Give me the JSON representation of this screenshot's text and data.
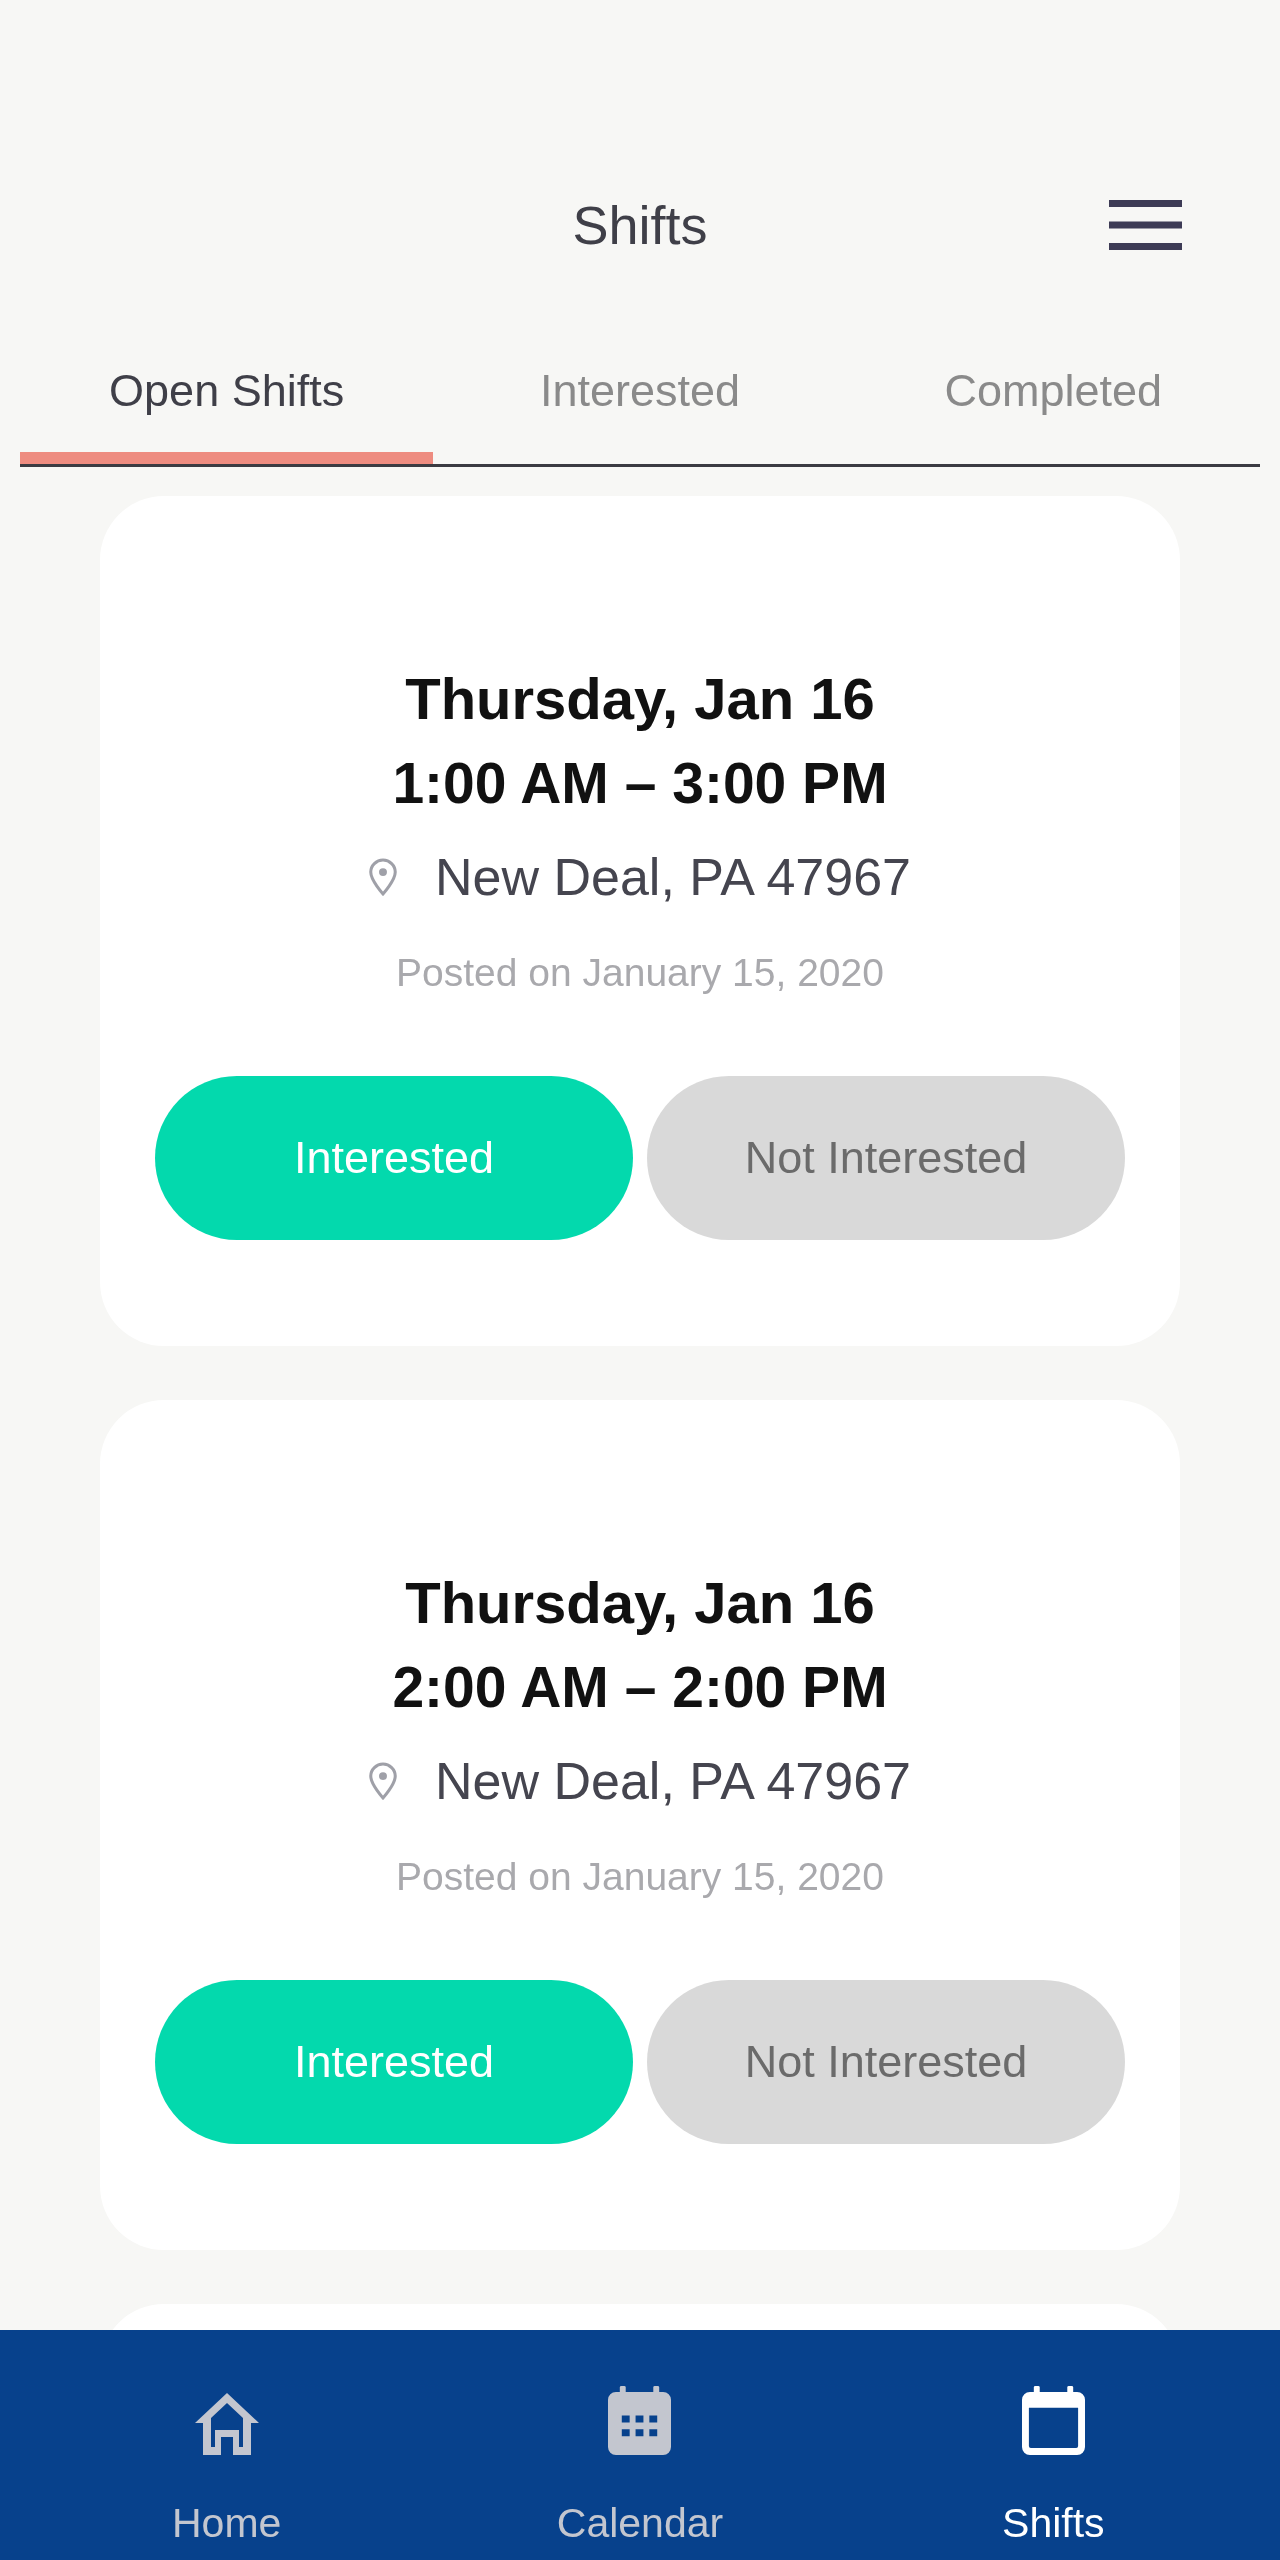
{
  "header": {
    "title": "Shifts"
  },
  "tabs": [
    {
      "label": "Open Shifts",
      "selected": true
    },
    {
      "label": "Interested",
      "selected": false
    },
    {
      "label": "Completed",
      "selected": false
    }
  ],
  "shifts": [
    {
      "date": "Thursday, Jan 16",
      "time": "1:00 AM – 3:00 PM",
      "location": "New Deal, PA 47967",
      "posted": "Posted on January 15, 2020",
      "actions": [
        {
          "label": "Interested",
          "kind": "primary"
        },
        {
          "label": "Not Interested",
          "kind": "secondary"
        }
      ]
    },
    {
      "date": "Thursday, Jan 16",
      "time": "2:00 AM – 2:00 PM",
      "location": "New Deal, PA 47967",
      "posted": "Posted on January 15, 2020",
      "actions": [
        {
          "label": "Interested",
          "kind": "primary"
        },
        {
          "label": "Not Interested",
          "kind": "secondary"
        }
      ]
    }
  ],
  "bottom_nav": [
    {
      "label": "Home",
      "selected": false
    },
    {
      "label": "Calendar",
      "selected": false
    },
    {
      "label": "Shifts",
      "selected": true
    }
  ]
}
